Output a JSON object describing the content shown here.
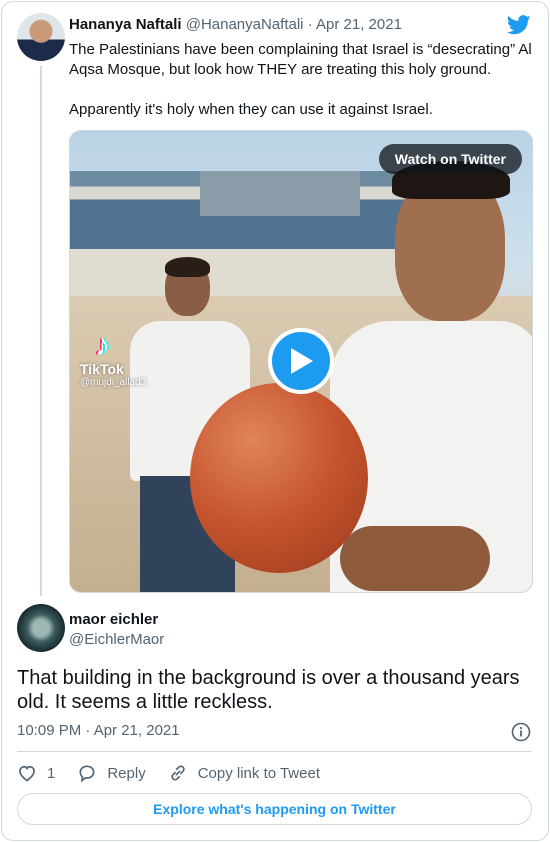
{
  "parent_tweet": {
    "author_name": "Hananya Naftali",
    "handle": "@HananyaNaftali",
    "separator": "·",
    "date": "Apr 21, 2021",
    "text_line1": "The Palestinians have been complaining that Israel is “desecrating” Al Aqsa Mosque, but look how THEY are treating this holy ground.",
    "text_line2": "Apparently it's holy when they can use it against Israel.",
    "brand_icon": "twitter-bird-icon",
    "media": {
      "watch_label": "Watch on Twitter",
      "play_icon": "play-icon",
      "watermark_label": "TikTok",
      "watermark_user": "@mujdi_allad3"
    }
  },
  "reply_tweet": {
    "author_name": "maor eichler",
    "handle": "@EichlerMaor",
    "text": "That building in the background is over a thousand years old. It seems a little reckless.",
    "timestamp": "10:09 PM · Apr 21, 2021",
    "like_count": "1",
    "reply_label": "Reply",
    "copy_link_label": "Copy link to Tweet"
  },
  "footer": {
    "explore_label": "Explore what's happening on Twitter"
  },
  "colors": {
    "accent": "#1d9bf0",
    "text_primary": "#0f1419",
    "text_secondary": "#536471",
    "border": "#cfd9de"
  }
}
